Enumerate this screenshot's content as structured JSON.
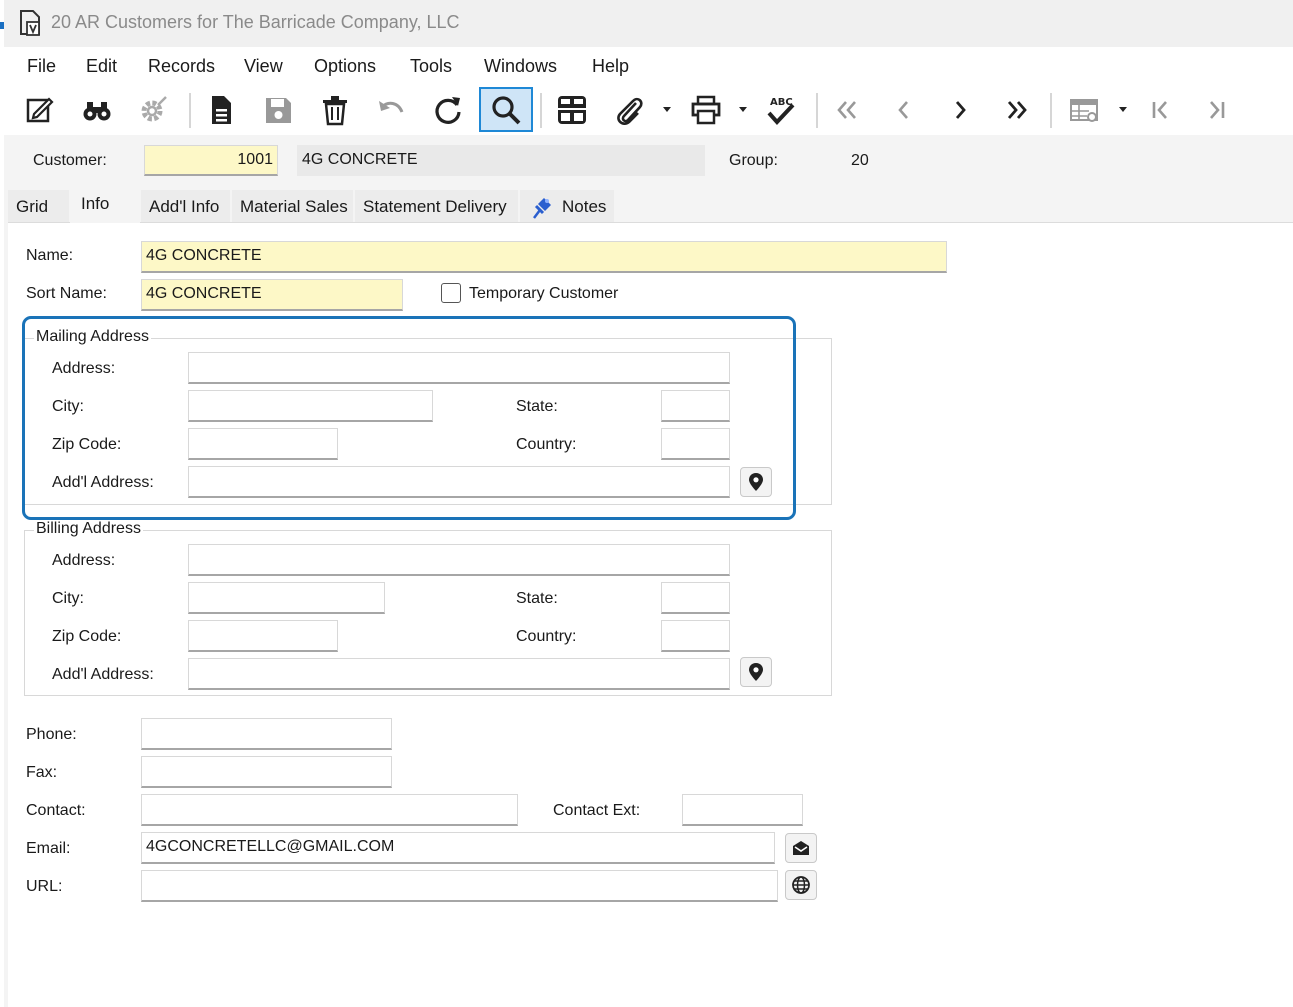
{
  "window": {
    "title": "20 AR Customers for The Barricade Company, LLC"
  },
  "menu": {
    "items": [
      "File",
      "Edit",
      "Records",
      "View",
      "Options",
      "Tools",
      "Windows",
      "Help"
    ]
  },
  "toolbar": {
    "icons": [
      "edit-icon",
      "binoculars-icon",
      "gear-icon",
      "new-document-icon",
      "save-icon",
      "delete-icon",
      "undo-icon",
      "refresh-icon",
      "search-icon",
      "grid-icon",
      "attach-icon",
      "print-icon",
      "spellcheck-icon",
      "first-record-icon",
      "previous-record-icon",
      "next-record-icon",
      "last-record-icon",
      "table-settings-icon",
      "first-page-icon",
      "last-page-icon"
    ],
    "spellcheck_text": "ABC"
  },
  "header": {
    "customer_label": "Customer:",
    "customer_number": "1001",
    "customer_name": "4G CONCRETE",
    "group_label": "Group:",
    "group_value": "20"
  },
  "tabs": [
    "Grid",
    "Info",
    "Add'l Info",
    "Material Sales",
    "Statement Delivery",
    "Notes"
  ],
  "info": {
    "name_label": "Name:",
    "name_value": "4G CONCRETE",
    "sort_name_label": "Sort Name:",
    "sort_name_value": "4G CONCRETE",
    "temporary_label": "Temporary Customer",
    "mailing": {
      "title": "Mailing Address",
      "address_label": "Address:",
      "city_label": "City:",
      "state_label": "State:",
      "zip_label": "Zip Code:",
      "country_label": "Country:",
      "addl_label": "Add'l Address:",
      "address": "",
      "city": "",
      "state": "",
      "zip": "",
      "country": "",
      "addl": ""
    },
    "billing": {
      "title": "Billing Address",
      "address_label": "Address:",
      "city_label": "City:",
      "state_label": "State:",
      "zip_label": "Zip Code:",
      "country_label": "Country:",
      "addl_label": "Add'l Address:",
      "address": "",
      "city": "",
      "state": "",
      "zip": "",
      "country": "",
      "addl": ""
    },
    "phone_label": "Phone:",
    "phone": "",
    "fax_label": "Fax:",
    "fax": "",
    "contact_label": "Contact:",
    "contact": "",
    "contact_ext_label": "Contact Ext:",
    "contact_ext": "",
    "email_label": "Email:",
    "email": "4GCONCRETELLC@GMAIL.COM",
    "url_label": "URL:",
    "url": ""
  },
  "colors": {
    "required_field": "#fdf8c7",
    "highlight": "#1a73b8",
    "active_tool": "#cfe5f7"
  }
}
